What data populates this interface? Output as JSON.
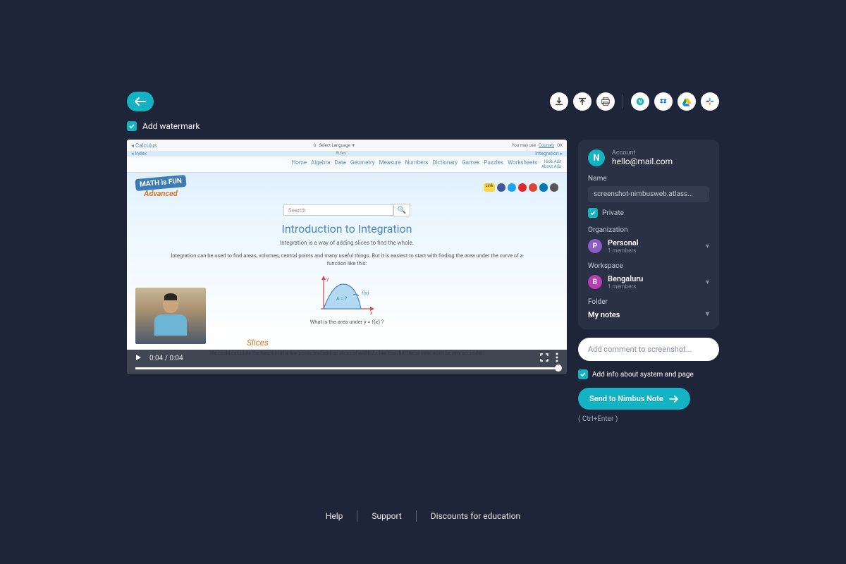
{
  "toolbar": {
    "watermark_label": "Add watermark"
  },
  "video": {
    "time": "0:04 / 0:04",
    "browser": {
      "crumb_top": "Calculus",
      "crumb_bot": "Index",
      "right_crumb": "Integration",
      "lang": "Select Language  ▼",
      "ok": "OK",
      "courses": "Courses",
      "may_use": "You may use",
      "nav": [
        "Home",
        "Algebra",
        "Data",
        "Geometry",
        "Measure",
        "Numbers",
        "Dictionary",
        "Games",
        "Puzzles",
        "Worksheets"
      ],
      "hide_ads": "Hide Ads",
      "about_ads": "About Ads",
      "logo_top": "MATH is FUN",
      "logo_bot": "Advanced",
      "search_ph": "Search",
      "title": "Introduction to Integration",
      "sub": "Integration is a way of adding slices to find the whole.",
      "text": "Integration can be used to find areas, volumes, central points and many useful things. But it is easiest to start with finding the area under the curve of a function like this:",
      "caption": "What is the area under y = f(x) ?",
      "fx": "f(x)",
      "area": "A = ?",
      "slices": "Slices",
      "slices_text": "We could calculate the function at a few points and add up slices of width Δx like this (but the answer won't be very accurate):"
    }
  },
  "panel": {
    "account_label": "Account",
    "account_email": "hello@mail.com",
    "name_label": "Name",
    "name_value": "screenshot-nimbusweb.atlass...",
    "private_label": "Private",
    "org_label": "Organization",
    "org_name": "Personal",
    "org_members": "1 members",
    "ws_label": "Workspace",
    "ws_name": "Bengaluru",
    "ws_members": "1 members",
    "folder_label": "Folder",
    "folder_value": "My notes"
  },
  "comment": {
    "placeholder": "Add comment to screenshot...",
    "info_label": "Add info about system and page",
    "send_label": "Send to Nimbus Note",
    "shortcut": "( Ctrl+Enter )"
  },
  "footer": {
    "help": "Help",
    "support": "Support",
    "discounts": "Discounts for education"
  }
}
